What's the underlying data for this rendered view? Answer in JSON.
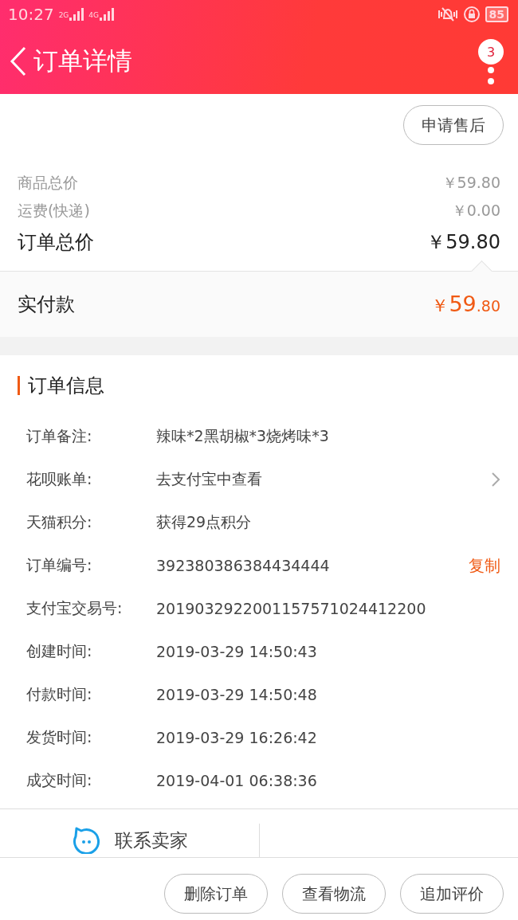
{
  "status_bar": {
    "time": "10:27",
    "networks": [
      "2G",
      "4G"
    ],
    "battery": "85"
  },
  "header": {
    "title": "订单详情",
    "badge": "3"
  },
  "after_sale_button": "申请售后",
  "price_rows": [
    {
      "kind": "minor",
      "label": "商品总价",
      "value": "￥59.80"
    },
    {
      "kind": "minor",
      "label": "运费(快递)",
      "value": "￥0.00"
    },
    {
      "kind": "major",
      "label": "订单总价",
      "value": "￥59.80"
    }
  ],
  "paid": {
    "label": "实付款",
    "symbol": "￥",
    "main": "59",
    "fraction": ".80"
  },
  "order_info": {
    "title": "订单信息",
    "rows": [
      {
        "kind": "plain",
        "label": "订单备注:",
        "value": "辣味*2黑胡椒*3烧烤味*3"
      },
      {
        "kind": "link",
        "label": "花呗账单:",
        "value": "去支付宝中查看"
      },
      {
        "kind": "plain",
        "label": "天猫积分:",
        "value": "获得29点积分"
      },
      {
        "kind": "copy",
        "label": "订单编号:",
        "value": "392380386384434444",
        "action": "复制"
      },
      {
        "kind": "plain",
        "label": "支付宝交易号:",
        "value": "2019032922001157571024412200"
      },
      {
        "kind": "plain",
        "label": "创建时间:",
        "value": "2019-03-29 14:50:43"
      },
      {
        "kind": "plain",
        "label": "付款时间:",
        "value": "2019-03-29 14:50:48"
      },
      {
        "kind": "plain",
        "label": "发货时间:",
        "value": "2019-03-29 16:26:42"
      },
      {
        "kind": "plain",
        "label": "成交时间:",
        "value": "2019-04-01 06:38:36"
      }
    ]
  },
  "contact_seller": "联系卖家",
  "bottom_buttons": [
    "删除订单",
    "查看物流",
    "追加评价"
  ]
}
